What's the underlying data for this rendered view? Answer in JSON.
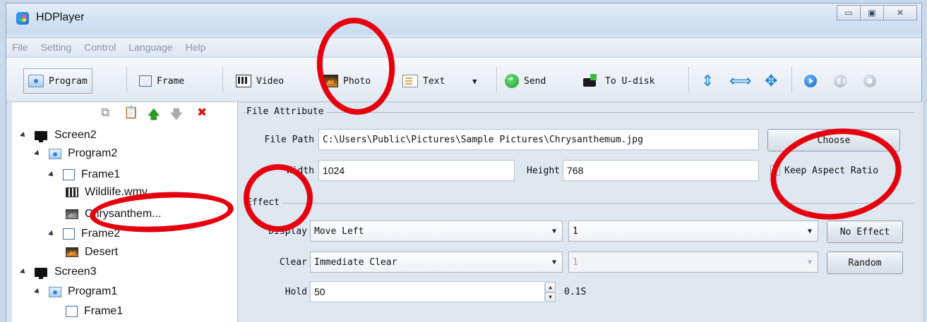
{
  "window": {
    "title": "HDPlayer",
    "controls": {
      "minimize": "▭",
      "maximize": "▣",
      "close": "✕"
    }
  },
  "menu": [
    "File",
    "Setting",
    "Control",
    "Language",
    "Help"
  ],
  "toolbar": {
    "program": "Program",
    "frame": "Frame",
    "video": "Video",
    "photo": "Photo",
    "text": "Text",
    "send": "Send",
    "to_udisk": "To U-disk"
  },
  "left_tools": {
    "copy_icon": "copy-icon",
    "paste_icon": "paste-icon",
    "up_icon": "arrow-up-icon",
    "down_icon": "arrow-down-icon",
    "delete_icon": "delete-icon"
  },
  "tree": [
    {
      "label": "Screen2",
      "type": "screen"
    },
    {
      "label": "Program2",
      "type": "program"
    },
    {
      "label": "Frame1",
      "type": "frame"
    },
    {
      "label": "Wildlife.wmv",
      "type": "video"
    },
    {
      "label": "Chrysanthem...",
      "type": "photo",
      "selected": true
    },
    {
      "label": "Frame2",
      "type": "frame"
    },
    {
      "label": "Desert",
      "type": "photo"
    },
    {
      "label": "Screen3",
      "type": "screen"
    },
    {
      "label": "Program1",
      "type": "program"
    },
    {
      "label": "Frame1",
      "type": "frame"
    }
  ],
  "file_attribute": {
    "title": "File Attribute",
    "file_path_label": "File Path",
    "file_path": "C:\\Users\\Public\\Pictures\\Sample Pictures\\Chrysanthemum.jpg",
    "choose_label": "Choose",
    "width_label": "Width",
    "width": "1024",
    "height_label": "Height",
    "height": "768",
    "keep_aspect_label": "Keep Aspect Ratio",
    "keep_aspect_checked": false
  },
  "effect": {
    "title": "Effect",
    "display_label": "Display",
    "display_value": "Move Left",
    "display_speed": "1",
    "no_effect_label": "No Effect",
    "clear_label": "Clear",
    "clear_value": "Immediate Clear",
    "clear_speed": "1",
    "random_label": "Random",
    "hold_label": "Hold",
    "hold_value": "50",
    "hold_unit": "0.1S"
  },
  "colors": {
    "annotation": "#e5000e",
    "accent": "#1a7fd8"
  }
}
